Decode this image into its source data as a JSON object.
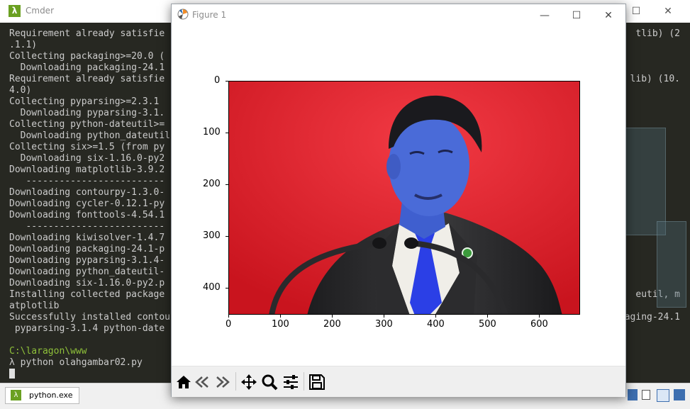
{
  "cmder": {
    "title": "Cmder",
    "logo_glyph": "λ",
    "controls": {
      "minimize": "—",
      "maximize": "☐",
      "close": "✕"
    },
    "terminal_lines": [
      "Requirement already satisfie",
      ".1.1)",
      "Collecting packaging>=20.0 (",
      "  Downloading packaging-24.1",
      "Requirement already satisfie",
      "4.0)",
      "Collecting pyparsing>=2.3.1 ",
      "  Downloading pyparsing-3.1.",
      "Collecting python-dateutil>=",
      "  Downloading python_dateutil",
      "Collecting six>=1.5 (from py",
      "  Downloading six-1.16.0-py2",
      "Downloading matplotlib-3.9.2",
      "   -------------------------",
      "Downloading contourpy-1.3.0-",
      "Downloading cycler-0.12.1-py",
      "Downloading fonttools-4.54.1",
      "   -------------------------",
      "Downloading kiwisolver-1.4.7",
      "Downloading packaging-24.1-p",
      "Downloading pyparsing-3.1.4-",
      "Downloading python_dateutil-",
      "Downloading six-1.16.0-py2.p",
      "Installing collected package",
      "atplotlib",
      "Successfully installed contou",
      " pyparsing-3.1.4 python-date"
    ],
    "terminal_right_fragments": [
      {
        "line": 0,
        "text": "tlib) (2"
      },
      {
        "line": 4,
        "text": "lib) (10."
      },
      {
        "line": 23,
        "text": "eutil, m"
      },
      {
        "line": 25,
        "text": "aging-24.1"
      }
    ],
    "prompt_path": "C:\\laragon\\www",
    "prompt_command": "λ python olahgambar02.py",
    "taskbar_tab": "python.exe"
  },
  "figure": {
    "title": "Figure 1",
    "controls": {
      "minimize": "—",
      "maximize": "☐",
      "close": "✕"
    },
    "toolbar": {
      "home": "home-icon",
      "back": "back-arrow-icon",
      "forward": "forward-arrow-icon",
      "pan": "pan-icon",
      "zoom": "zoom-icon",
      "configure": "configure-subplots-icon",
      "save": "save-icon"
    },
    "axes": {
      "xticks": [
        "0",
        "100",
        "200",
        "300",
        "400",
        "500",
        "600"
      ],
      "yticks": [
        "0",
        "100",
        "200",
        "300",
        "400"
      ],
      "image_description_colors": {
        "background": "#e8202a",
        "face": "#4a6bd8",
        "suit": "#2a2a2a",
        "tie": "#2b3fe6",
        "shirt": "#f0eee8"
      }
    }
  }
}
